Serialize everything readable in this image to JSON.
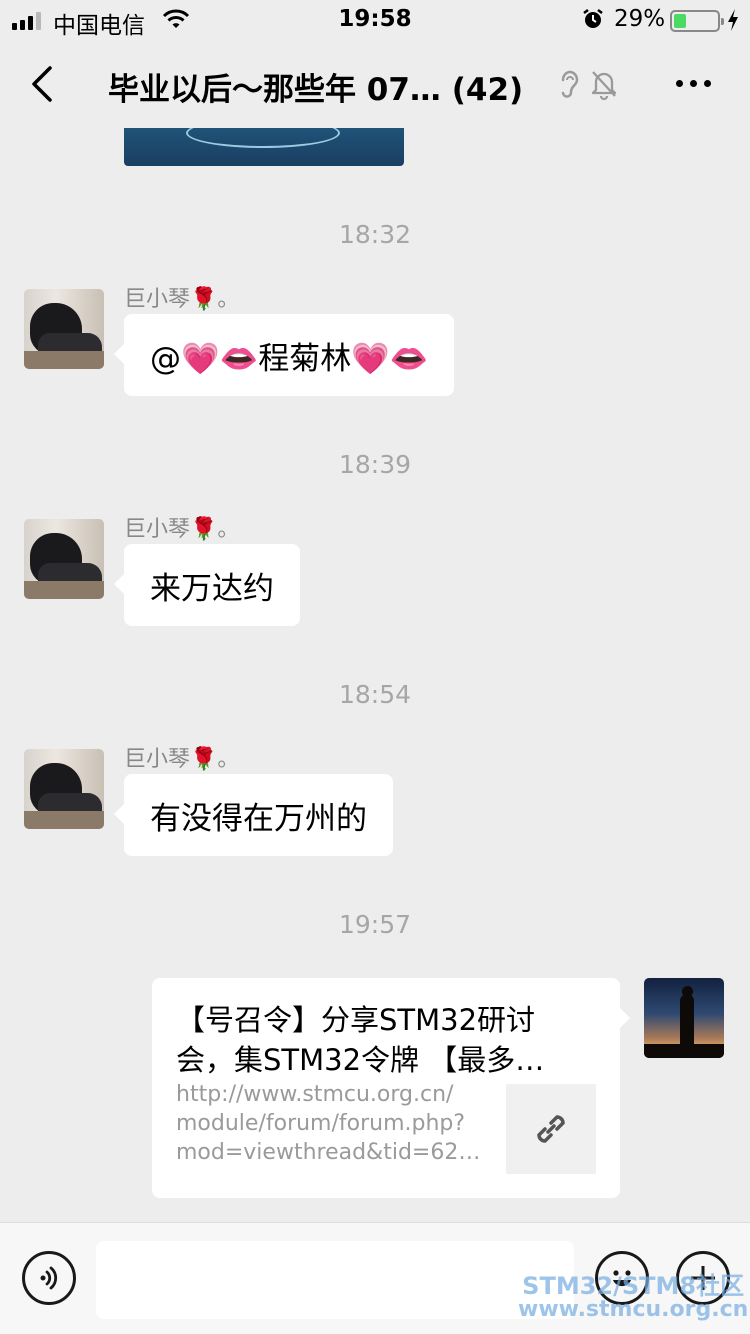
{
  "status_bar": {
    "carrier": "中国电信",
    "time": "19:58",
    "battery_percent": "29%",
    "battery_level": 0.29,
    "signal_bars": 4,
    "signal_active": 3,
    "icons": [
      "signal-icon",
      "wifi-icon",
      "alarm-icon",
      "battery-icon",
      "charging-icon"
    ]
  },
  "nav": {
    "title": "毕业以后～那些年  07… (42)",
    "icons": [
      "back-icon",
      "ear-icon",
      "mute-icon",
      "more-icon"
    ]
  },
  "messages": [
    {
      "type": "time",
      "text": "18:32"
    },
    {
      "type": "text",
      "sender": "巨小琴🌹。",
      "text": "@💗👄程菊林💗👄",
      "side": "left"
    },
    {
      "type": "time",
      "text": "18:39"
    },
    {
      "type": "text",
      "sender": "巨小琴🌹。",
      "text": "来万达约",
      "side": "left"
    },
    {
      "type": "time",
      "text": "18:54"
    },
    {
      "type": "text",
      "sender": "巨小琴🌹。",
      "text": "有没得在万州的",
      "side": "left"
    },
    {
      "type": "time",
      "text": "19:57"
    },
    {
      "type": "link",
      "side": "right",
      "title_line1": "【号召令】分享STM32研讨",
      "title_line2": "会，集STM32令牌 【最多…",
      "desc_line1": "http://www.stmcu.org.cn/",
      "desc_line2": "module/forum/forum.php?",
      "desc_line3": "mod=viewthread&tid=62…",
      "thumb_icon": "link-icon"
    }
  ],
  "input_bar": {
    "icons": [
      "voice-icon",
      "emoji-icon",
      "plus-icon"
    ],
    "placeholder": ""
  },
  "watermark": {
    "line1": "STM32/STM8社区",
    "line2": "www.stmcu.org.cn"
  },
  "colors": {
    "background": "#ededed",
    "bubble": "#ffffff",
    "timestamp": "#a6a6a6",
    "battery_fill": "#4cd964"
  }
}
